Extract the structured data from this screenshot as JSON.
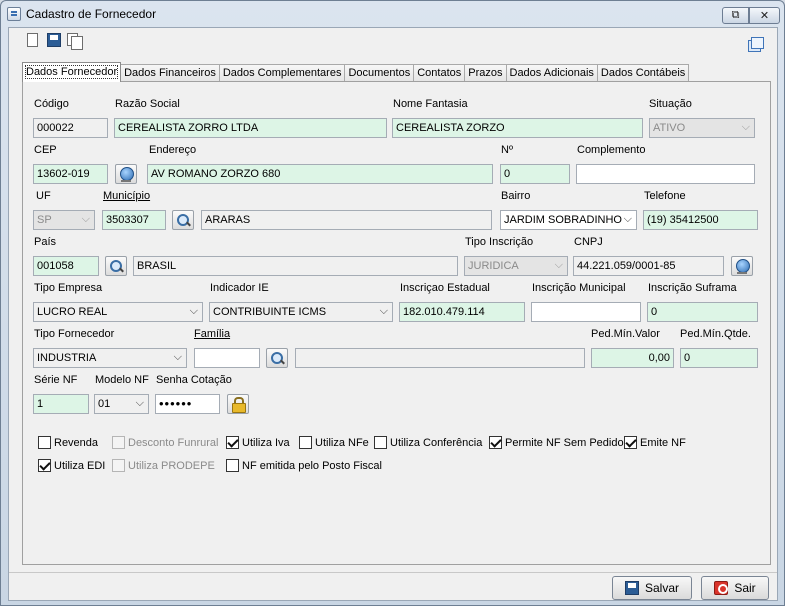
{
  "window": {
    "title": "Cadastro de Fornecedor",
    "restore_glyph": "⧉",
    "close_glyph": "✕"
  },
  "toolbar": {
    "icons": [
      "new-document-icon",
      "save-icon",
      "copy-icon",
      "windows-icon"
    ]
  },
  "tabs": [
    {
      "label": "Dados Fornecedor",
      "active": true
    },
    {
      "label": "Dados Financeiros"
    },
    {
      "label": "Dados Complementares"
    },
    {
      "label": "Documentos"
    },
    {
      "label": "Contatos"
    },
    {
      "label": "Prazos"
    },
    {
      "label": "Dados Adicionais"
    },
    {
      "label": "Dados Contábeis"
    }
  ],
  "form": {
    "codigo": {
      "label": "Código",
      "value": "000022"
    },
    "razao_social": {
      "label": "Razão Social",
      "value": "CEREALISTA ZORRO LTDA"
    },
    "nome_fantasia": {
      "label": "Nome Fantasia",
      "value": "CEREALISTA ZORZO"
    },
    "situacao": {
      "label": "Situação",
      "value": "ATIVO"
    },
    "cep": {
      "label": "CEP",
      "value": "13602-019"
    },
    "endereco": {
      "label": "Endereço",
      "value": "AV ROMANO ZORZO 680"
    },
    "numero": {
      "label": "Nº",
      "value": "0"
    },
    "complemento": {
      "label": "Complemento",
      "value": ""
    },
    "uf": {
      "label": "UF",
      "value": "SP"
    },
    "municipio": {
      "label": "Município",
      "code": "3503307",
      "name": "ARARAS"
    },
    "bairro": {
      "label": "Bairro",
      "value": "JARDIM SOBRADINHO"
    },
    "telefone": {
      "label": "Telefone",
      "value": "(19) 35412500"
    },
    "pais": {
      "label": "País",
      "code": "001058",
      "name": "BRASIL"
    },
    "tipo_inscricao": {
      "label": "Tipo Inscrição",
      "value": "JURIDICA"
    },
    "cnpj": {
      "label": "CNPJ",
      "value": "44.221.059/0001-85"
    },
    "tipo_empresa": {
      "label": "Tipo Empresa",
      "value": "LUCRO REAL"
    },
    "indicador_ie": {
      "label": "Indicador IE",
      "value": "CONTRIBUINTE ICMS"
    },
    "inscricao_estadual": {
      "label": "Inscriçao Estadual",
      "value": "182.010.479.114"
    },
    "inscricao_municipal": {
      "label": "Inscrição Municipal",
      "value": ""
    },
    "inscricao_suframa": {
      "label": "Inscrição Suframa",
      "value": "0"
    },
    "tipo_fornecedor": {
      "label": "Tipo Fornecedor",
      "value": "INDUSTRIA"
    },
    "familia": {
      "label": "Família",
      "code": "",
      "name": ""
    },
    "ped_min_valor": {
      "label": "Ped.Mín.Valor",
      "value": "0,00"
    },
    "ped_min_qtde": {
      "label": "Ped.Mín.Qtde.",
      "value": "0"
    },
    "serie_nf": {
      "label": "Série NF",
      "value": "1"
    },
    "modelo_nf": {
      "label": "Modelo NF",
      "value": "01"
    },
    "senha_cotacao": {
      "label": "Senha Cotação",
      "value": "••••••"
    }
  },
  "checkboxes": [
    {
      "label": "Revenda",
      "checked": false,
      "disabled": false
    },
    {
      "label": "Desconto Funrural",
      "checked": false,
      "disabled": true
    },
    {
      "label": "Utiliza Iva",
      "checked": true,
      "disabled": false
    },
    {
      "label": "Utiliza NFe",
      "checked": false,
      "disabled": false
    },
    {
      "label": "Utiliza Conferência",
      "checked": false,
      "disabled": false
    },
    {
      "label": "Permite NF Sem Pedido",
      "checked": true,
      "disabled": false
    },
    {
      "label": "Emite NF",
      "checked": true,
      "disabled": false
    },
    {
      "label": "Utiliza EDI",
      "checked": true,
      "disabled": false
    },
    {
      "label": "Utiliza PRODEPE",
      "checked": false,
      "disabled": true
    },
    {
      "label": "NF emitida pelo Posto Fiscal",
      "checked": false,
      "disabled": false
    }
  ],
  "buttons": {
    "save": "Salvar",
    "exit": "Sair"
  },
  "colors": {
    "field_green": "#ddf5e6",
    "panel_bg": "#f0f0f0",
    "title_bg": "#c9d6e4"
  }
}
